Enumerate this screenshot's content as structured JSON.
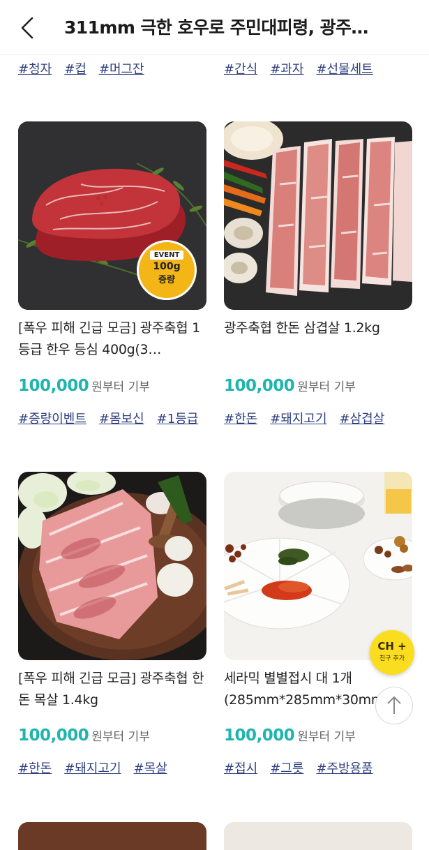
{
  "header": {
    "title": "311mm 극한 호우로 주민대피령, 광주…"
  },
  "top_tags": {
    "left": [
      "#청자",
      "#컵",
      "#머그잔"
    ],
    "right": [
      "#간식",
      "#과자",
      "#선물세트"
    ]
  },
  "products": [
    {
      "name": "[폭우 피해 긴급 모금] 광주축협 1등급 한우 등심 400g(3…",
      "price": "100,000",
      "price_suffix": "원부터 기부",
      "tags": [
        "#증량이벤트",
        "#몸보신",
        "#1등급"
      ],
      "badge": {
        "label": "EVENT",
        "line1": "100g",
        "line2": "증량"
      }
    },
    {
      "name": "광주축협 한돈 삼겹살 1.2kg",
      "price": "100,000",
      "price_suffix": "원부터 기부",
      "tags": [
        "#한돈",
        "#돼지고기",
        "#삼겹살"
      ]
    },
    {
      "name": "[폭우 피해 긴급 모금] 광주축협 한돈 목살 1.4kg",
      "price": "100,000",
      "price_suffix": "원부터 기부",
      "tags": [
        "#한돈",
        "#돼지고기",
        "#목살"
      ]
    },
    {
      "name": "세라믹 별별접시 대 1개(285mm*285mm*30mm)",
      "price": "100,000",
      "price_suffix": "원부터 기부",
      "tags": [
        "#접시",
        "#그릇",
        "#주방용품"
      ]
    }
  ],
  "floating": {
    "channel_title": "CH +",
    "channel_sub": "친구 추가"
  },
  "colors": {
    "accent": "#1fb5ad",
    "tag": "#2f3f7e",
    "kakao": "#f9dd1e",
    "event": "#f4b617"
  }
}
